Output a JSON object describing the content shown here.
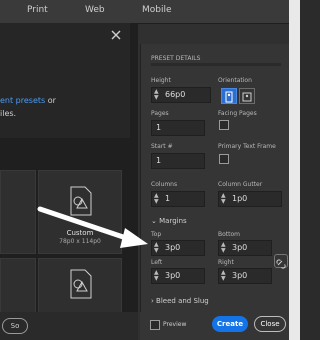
{
  "tabs": [
    "Print",
    "Web",
    "Mobile"
  ],
  "dialog": {
    "line1_link": "ent presets",
    "line1_rest": " or",
    "line2": "iles."
  },
  "presets": {
    "custom_name": "Custom",
    "custom_size": "78p0 x 114p0"
  },
  "panel": {
    "header": "PRESET DETAILS",
    "height_label": "Height",
    "height_value": "66p0",
    "orientation_label": "Orientation",
    "pages_label": "Pages",
    "pages_value": "1",
    "facing_pages_label": "Facing Pages",
    "start_label": "Start #",
    "start_value": "1",
    "primary_text_frame_label": "Primary Text Frame",
    "columns_label": "Columns",
    "columns_value": "1",
    "gutter_label": "Column Gutter",
    "gutter_value": "1p0",
    "margins_label": "Margins",
    "top_label": "Top",
    "top_value": "3p0",
    "bottom_label": "Bottom",
    "bottom_value": "3p0",
    "left_label": "Left",
    "left_value": "3p0",
    "right_label": "Right",
    "right_value": "3p0",
    "bleed_label": "Bleed and Slug"
  },
  "footer": {
    "preview_label": "Preview",
    "create_label": "Create",
    "close_label": "Close",
    "left_pill": "So"
  },
  "colors": {
    "accent": "#1473e6",
    "orientation_active": "#2d6fd0"
  }
}
